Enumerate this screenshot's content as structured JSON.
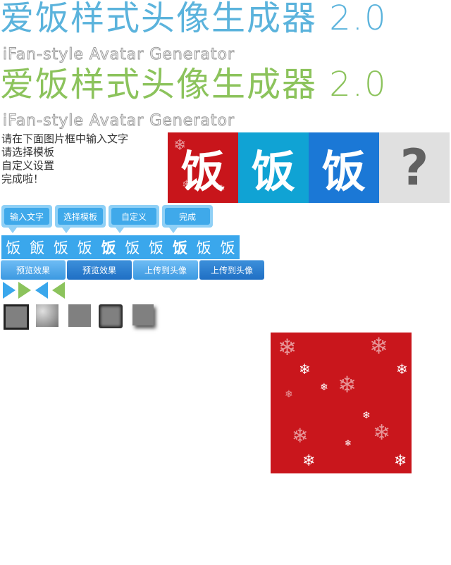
{
  "header": {
    "title_cn_1": "爱饭样式头像生成器 2.0",
    "subtitle_en_1": "iFan-style Avatar Generator",
    "title_cn_2": "爱饭样式头像生成器 2.0",
    "subtitle_en_2": "iFan-style Avatar Generator"
  },
  "steps": [
    "请在下面图片框中输入文字",
    "请选择模板",
    "自定义设置",
    "完成啦！"
  ],
  "previews": [
    {
      "char": "饭",
      "bg": "#c8151b"
    },
    {
      "char": "饭",
      "bg": "#10a3d4"
    },
    {
      "char": "饭",
      "bg": "#1b78d6"
    },
    {
      "char": "?",
      "bg": "#e0e0e0"
    }
  ],
  "tabs": [
    "输入文字",
    "选择模板",
    "自定义",
    "完成"
  ],
  "glyphs": [
    "饭",
    "飯",
    "饭",
    "饭",
    "饭",
    "饭",
    "饭",
    "饭",
    "饭",
    "饭"
  ],
  "buttons": [
    "预览效果",
    "预览效果",
    "上传到头像",
    "上传到头像"
  ],
  "colors": {
    "accent_blue": "#3aa7ec",
    "accent_green": "#8cc35c",
    "red": "#c8151b"
  }
}
